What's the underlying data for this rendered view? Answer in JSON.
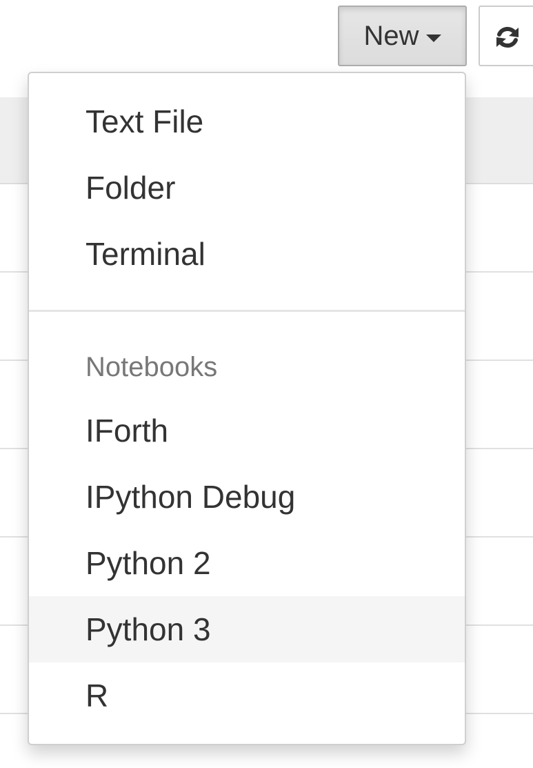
{
  "toolbar": {
    "new_label": "New"
  },
  "menu": {
    "file_items": [
      "Text File",
      "Folder",
      "Terminal"
    ],
    "notebooks_header": "Notebooks",
    "notebook_items": [
      "IForth",
      "IPython Debug",
      "Python 2",
      "Python 3",
      "R"
    ],
    "hovered_item": "Python 3"
  },
  "colors": {
    "button_bg": "#e6e6e6",
    "hover_bg": "#f5f5f5",
    "text": "#333333",
    "header_text": "#777777"
  },
  "icons": {
    "new_caret": "caret-down-icon",
    "refresh": "refresh-icon"
  }
}
